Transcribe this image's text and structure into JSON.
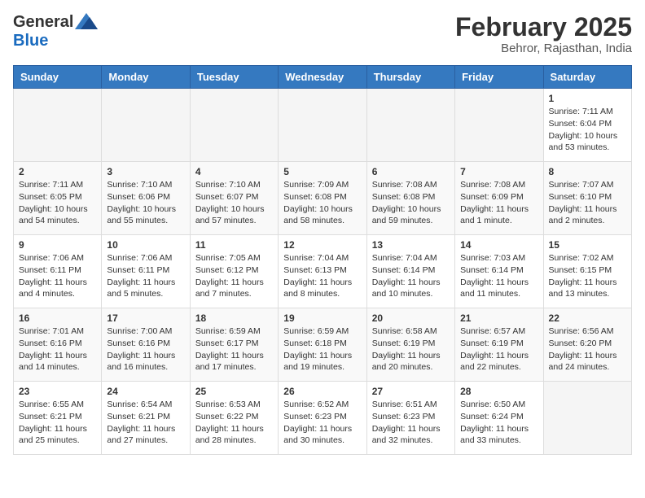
{
  "header": {
    "logo_general": "General",
    "logo_blue": "Blue",
    "month_year": "February 2025",
    "location": "Behror, Rajasthan, India"
  },
  "weekdays": [
    "Sunday",
    "Monday",
    "Tuesday",
    "Wednesday",
    "Thursday",
    "Friday",
    "Saturday"
  ],
  "weeks": [
    [
      {
        "day": "",
        "info": ""
      },
      {
        "day": "",
        "info": ""
      },
      {
        "day": "",
        "info": ""
      },
      {
        "day": "",
        "info": ""
      },
      {
        "day": "",
        "info": ""
      },
      {
        "day": "",
        "info": ""
      },
      {
        "day": "1",
        "info": "Sunrise: 7:11 AM\nSunset: 6:04 PM\nDaylight: 10 hours\nand 53 minutes."
      }
    ],
    [
      {
        "day": "2",
        "info": "Sunrise: 7:11 AM\nSunset: 6:05 PM\nDaylight: 10 hours\nand 54 minutes."
      },
      {
        "day": "3",
        "info": "Sunrise: 7:10 AM\nSunset: 6:06 PM\nDaylight: 10 hours\nand 55 minutes."
      },
      {
        "day": "4",
        "info": "Sunrise: 7:10 AM\nSunset: 6:07 PM\nDaylight: 10 hours\nand 57 minutes."
      },
      {
        "day": "5",
        "info": "Sunrise: 7:09 AM\nSunset: 6:08 PM\nDaylight: 10 hours\nand 58 minutes."
      },
      {
        "day": "6",
        "info": "Sunrise: 7:08 AM\nSunset: 6:08 PM\nDaylight: 10 hours\nand 59 minutes."
      },
      {
        "day": "7",
        "info": "Sunrise: 7:08 AM\nSunset: 6:09 PM\nDaylight: 11 hours\nand 1 minute."
      },
      {
        "day": "8",
        "info": "Sunrise: 7:07 AM\nSunset: 6:10 PM\nDaylight: 11 hours\nand 2 minutes."
      }
    ],
    [
      {
        "day": "9",
        "info": "Sunrise: 7:06 AM\nSunset: 6:11 PM\nDaylight: 11 hours\nand 4 minutes."
      },
      {
        "day": "10",
        "info": "Sunrise: 7:06 AM\nSunset: 6:11 PM\nDaylight: 11 hours\nand 5 minutes."
      },
      {
        "day": "11",
        "info": "Sunrise: 7:05 AM\nSunset: 6:12 PM\nDaylight: 11 hours\nand 7 minutes."
      },
      {
        "day": "12",
        "info": "Sunrise: 7:04 AM\nSunset: 6:13 PM\nDaylight: 11 hours\nand 8 minutes."
      },
      {
        "day": "13",
        "info": "Sunrise: 7:04 AM\nSunset: 6:14 PM\nDaylight: 11 hours\nand 10 minutes."
      },
      {
        "day": "14",
        "info": "Sunrise: 7:03 AM\nSunset: 6:14 PM\nDaylight: 11 hours\nand 11 minutes."
      },
      {
        "day": "15",
        "info": "Sunrise: 7:02 AM\nSunset: 6:15 PM\nDaylight: 11 hours\nand 13 minutes."
      }
    ],
    [
      {
        "day": "16",
        "info": "Sunrise: 7:01 AM\nSunset: 6:16 PM\nDaylight: 11 hours\nand 14 minutes."
      },
      {
        "day": "17",
        "info": "Sunrise: 7:00 AM\nSunset: 6:16 PM\nDaylight: 11 hours\nand 16 minutes."
      },
      {
        "day": "18",
        "info": "Sunrise: 6:59 AM\nSunset: 6:17 PM\nDaylight: 11 hours\nand 17 minutes."
      },
      {
        "day": "19",
        "info": "Sunrise: 6:59 AM\nSunset: 6:18 PM\nDaylight: 11 hours\nand 19 minutes."
      },
      {
        "day": "20",
        "info": "Sunrise: 6:58 AM\nSunset: 6:19 PM\nDaylight: 11 hours\nand 20 minutes."
      },
      {
        "day": "21",
        "info": "Sunrise: 6:57 AM\nSunset: 6:19 PM\nDaylight: 11 hours\nand 22 minutes."
      },
      {
        "day": "22",
        "info": "Sunrise: 6:56 AM\nSunset: 6:20 PM\nDaylight: 11 hours\nand 24 minutes."
      }
    ],
    [
      {
        "day": "23",
        "info": "Sunrise: 6:55 AM\nSunset: 6:21 PM\nDaylight: 11 hours\nand 25 minutes."
      },
      {
        "day": "24",
        "info": "Sunrise: 6:54 AM\nSunset: 6:21 PM\nDaylight: 11 hours\nand 27 minutes."
      },
      {
        "day": "25",
        "info": "Sunrise: 6:53 AM\nSunset: 6:22 PM\nDaylight: 11 hours\nand 28 minutes."
      },
      {
        "day": "26",
        "info": "Sunrise: 6:52 AM\nSunset: 6:23 PM\nDaylight: 11 hours\nand 30 minutes."
      },
      {
        "day": "27",
        "info": "Sunrise: 6:51 AM\nSunset: 6:23 PM\nDaylight: 11 hours\nand 32 minutes."
      },
      {
        "day": "28",
        "info": "Sunrise: 6:50 AM\nSunset: 6:24 PM\nDaylight: 11 hours\nand 33 minutes."
      },
      {
        "day": "",
        "info": ""
      }
    ]
  ]
}
